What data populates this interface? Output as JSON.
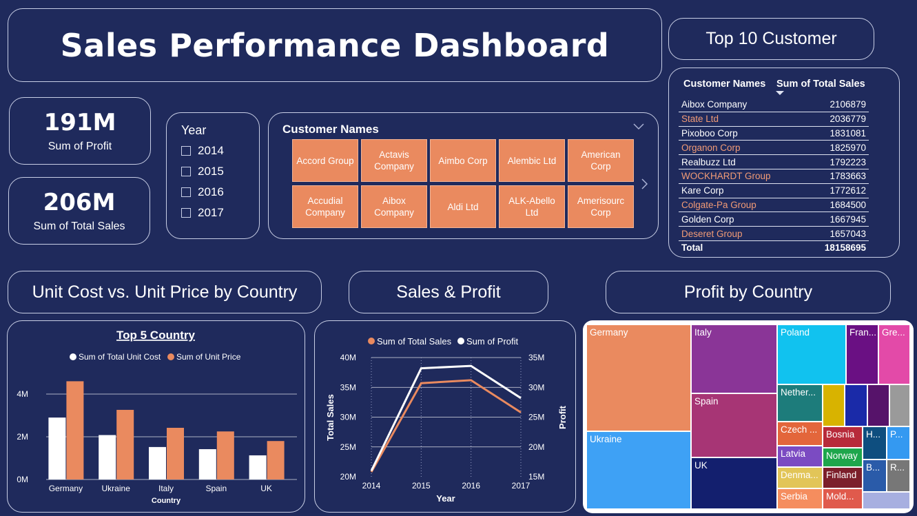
{
  "header": {
    "title": "Sales Performance Dashboard"
  },
  "kpis": [
    {
      "value": "191M",
      "label": "Sum of Profit"
    },
    {
      "value": "206M",
      "label": "Sum of Total Sales"
    }
  ],
  "year_slicer": {
    "title": "Year",
    "options": [
      "2014",
      "2015",
      "2016",
      "2017"
    ]
  },
  "customer_slicer": {
    "title": "Customer Names",
    "items": [
      "Accord Group",
      "Actavis Company",
      "Aimbo Corp",
      "Alembic Ltd",
      "American Corp",
      "Accudial Company",
      "Aibox Company",
      "Aldi Ltd",
      "ALK-Abello Ltd",
      "Amerisourc Corp"
    ]
  },
  "top10": {
    "title": "Top 10 Customer",
    "columns": [
      "Customer Names",
      "Sum of Total Sales"
    ],
    "rows": [
      {
        "name": "Aibox Company",
        "value": "2106879"
      },
      {
        "name": "State Ltd",
        "value": "2036779"
      },
      {
        "name": "Pixoboo Corp",
        "value": "1831081"
      },
      {
        "name": "Organon Corp",
        "value": "1825970"
      },
      {
        "name": "Realbuzz Ltd",
        "value": "1792223"
      },
      {
        "name": "WOCKHARDT Group",
        "value": "1783663"
      },
      {
        "name": "Kare Corp",
        "value": "1772612"
      },
      {
        "name": "Colgate-Pa Group",
        "value": "1684500"
      },
      {
        "name": "Golden Corp",
        "value": "1667945"
      },
      {
        "name": "Deseret Group",
        "value": "1657043"
      }
    ],
    "total_label": "Total",
    "total_value": "18158695"
  },
  "section_titles": {
    "unit": "Unit Cost vs. Unit Price by Country",
    "sales": "Sales & Profit",
    "profit": "Profit by Country"
  },
  "colors": {
    "background": "#1f2a5c",
    "accent": "#ea8a5f",
    "white": "#ffffff"
  },
  "chart_data": [
    {
      "type": "bar",
      "title": "Top 5 Country",
      "xlabel": "Country",
      "ylabel": "",
      "categories": [
        "Germany",
        "Ukraine",
        "Italy",
        "Spain",
        "UK"
      ],
      "series": [
        {
          "name": "Sum of Total Unit Cost",
          "color": "#ffffff",
          "values": [
            2900000,
            2080000,
            1520000,
            1420000,
            1130000
          ]
        },
        {
          "name": "Sum of Unit Price",
          "color": "#ea8a5f",
          "values": [
            4600000,
            3260000,
            2420000,
            2250000,
            1800000
          ]
        }
      ],
      "ylim": [
        0,
        4000000
      ],
      "yticks": [
        "0M",
        "2M",
        "4M"
      ],
      "legend": "top-center",
      "grid": true
    },
    {
      "type": "line",
      "title": "",
      "x": [
        "2014",
        "2015",
        "2016",
        "2017"
      ],
      "xlabel": "Year",
      "ylabel": "Total Sales",
      "y2label": "Profit",
      "series": [
        {
          "name": "Sum of Total Sales",
          "color": "#ea8a5f",
          "axis": "left",
          "values": [
            20800000,
            35700000,
            36200000,
            30800000
          ]
        },
        {
          "name": "Sum of Profit",
          "color": "#ffffff",
          "axis": "right",
          "values": [
            16000000,
            33200000,
            33600000,
            28200000
          ]
        }
      ],
      "ylim": [
        20000000,
        40000000
      ],
      "y2lim": [
        15000000,
        35000000
      ],
      "yticks": [
        "20M",
        "25M",
        "30M",
        "35M",
        "40M"
      ],
      "y2ticks": [
        "15M",
        "20M",
        "25M",
        "30M",
        "35M"
      ],
      "legend": "top-center",
      "grid": true
    },
    {
      "type": "treemap",
      "title": "",
      "categories": [
        "Germany",
        "Ukraine",
        "Italy",
        "Spain",
        "UK",
        "Poland",
        "Fran...",
        "Gre...",
        "Nether...",
        "Czech ...",
        "Latvia",
        "Denma...",
        "Serbia",
        "Bosnia",
        "Norway",
        "Finland",
        "Mold...",
        "H...",
        "P...",
        "B...",
        "R..."
      ],
      "colors": [
        "#ea8a5f",
        "#3ea1f5",
        "#8a3597",
        "#a73575",
        "#131f6e",
        "#11c2ef",
        "#6a1083",
        "#e34aa8",
        "#1d7c7b",
        "#e3663b",
        "#7b4bc2",
        "#e2c558",
        "#f58d5e",
        "#b72a3a",
        "#1ea64c",
        "#7c1f2b",
        "#e05a4c",
        "#0e4e7f",
        "#3499f1",
        "#2a5ba9",
        "#777777"
      ]
    }
  ]
}
